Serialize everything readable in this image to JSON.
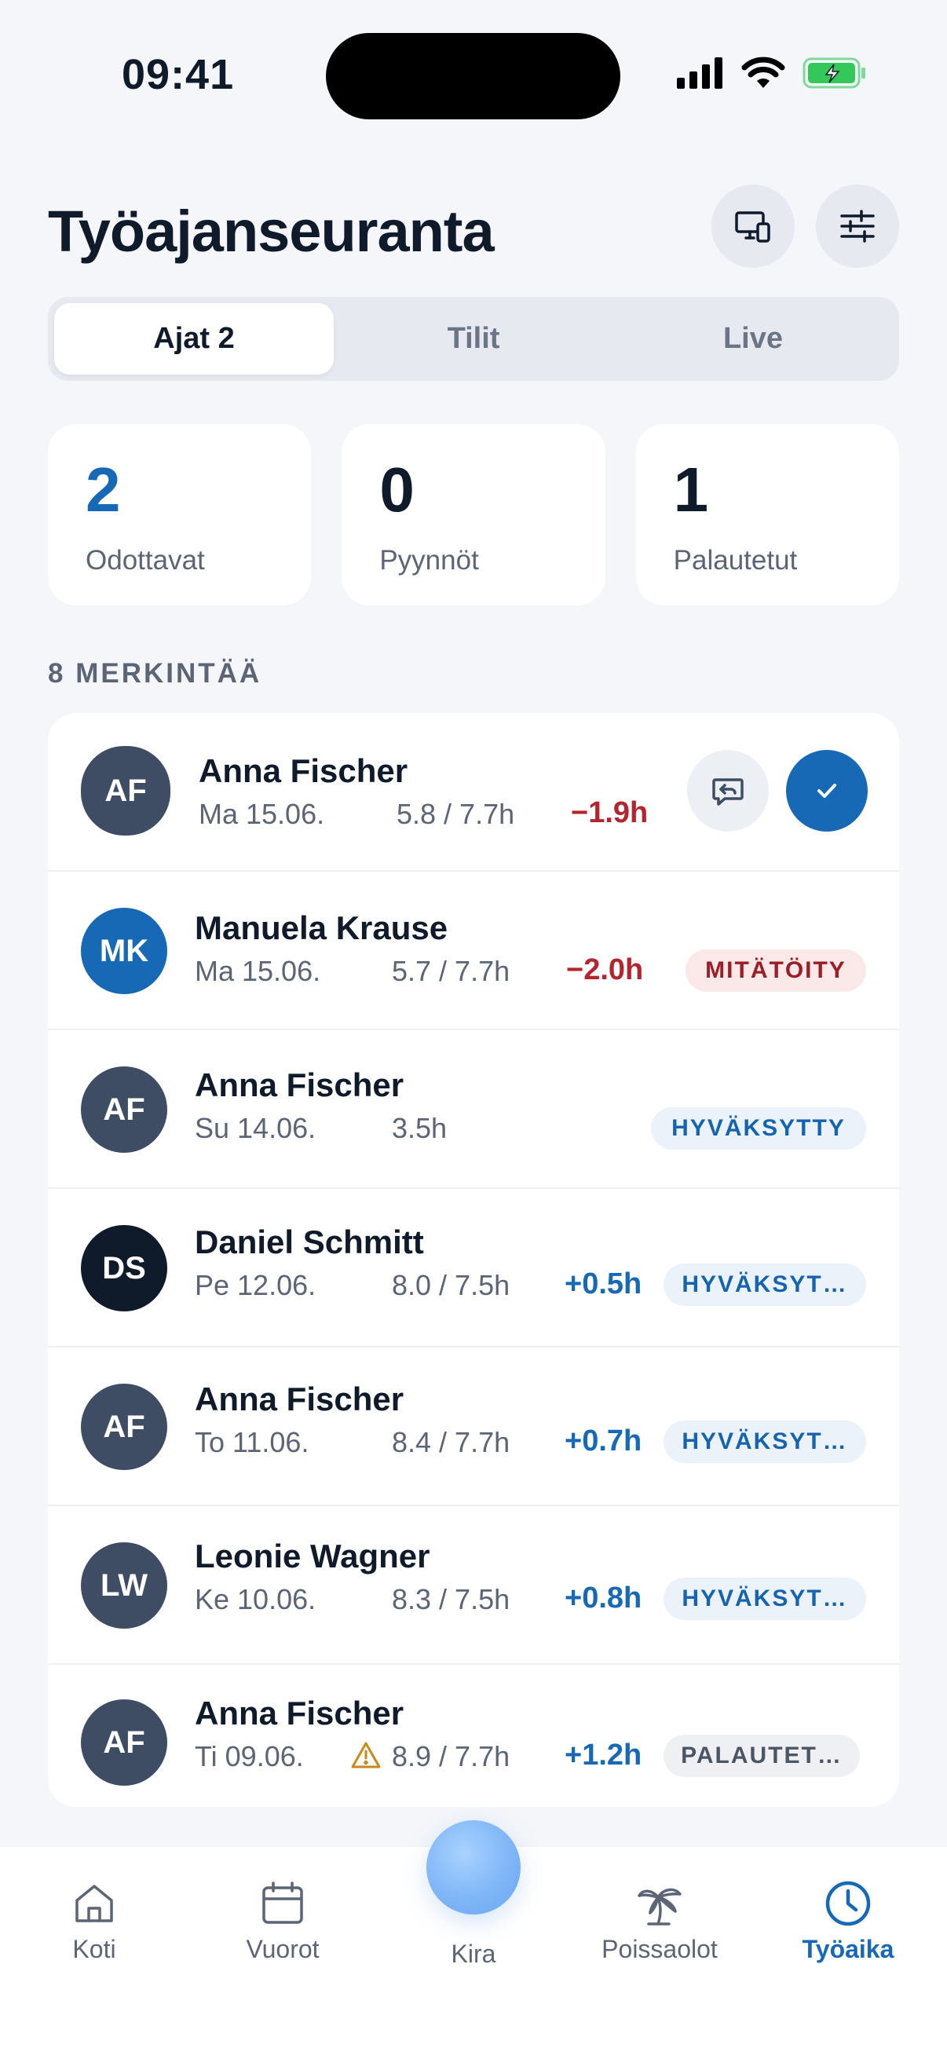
{
  "status": {
    "time": "09:41"
  },
  "header": {
    "title": "Työajanseuranta"
  },
  "segments": [
    {
      "label": "Ajat 2",
      "active": true
    },
    {
      "label": "Tilit",
      "active": false
    },
    {
      "label": "Live",
      "active": false
    }
  ],
  "stats": [
    {
      "value": "2",
      "label": "Odottavat",
      "color": "#1769b5"
    },
    {
      "value": "0",
      "label": "Pyynnöt",
      "color": "#0f1a2b"
    },
    {
      "value": "1",
      "label": "Palautetut",
      "color": "#0f1a2b"
    }
  ],
  "section": {
    "label": "8 MERKINTÄÄ"
  },
  "entries": [
    {
      "initials": "AF",
      "name": "Anna Fischer",
      "date": "Ma 15.06.",
      "hours": "5.8 / 7.7h",
      "delta": "−1.9h",
      "delta_type": "neg",
      "avatar_color": "#3f4d64",
      "status": ""
    },
    {
      "initials": "MK",
      "name": "Manuela Krause",
      "date": "Ma 15.06.",
      "hours": "5.7 / 7.7h",
      "delta": "−2.0h",
      "delta_type": "neg",
      "avatar_color": "#1769b5",
      "status": "MITÄTÖITY"
    },
    {
      "initials": "AF",
      "name": "Anna Fischer",
      "date": "Su 14.06.",
      "hours": "3.5h",
      "delta": "",
      "delta_type": "",
      "avatar_color": "#3f4d64",
      "status": "HYVÄKSYTTY"
    },
    {
      "initials": "DS",
      "name": "Daniel Schmitt",
      "date": "Pe 12.06.",
      "hours": "8.0 / 7.5h",
      "delta": "+0.5h",
      "delta_type": "pos",
      "avatar_color": "#0f1a2b",
      "status": "HYVÄKSYT…"
    },
    {
      "initials": "AF",
      "name": "Anna Fischer",
      "date": "To 11.06.",
      "hours": "8.4 / 7.7h",
      "delta": "+0.7h",
      "delta_type": "pos",
      "avatar_color": "#3f4d64",
      "status": "HYVÄKSYT…"
    },
    {
      "initials": "LW",
      "name": "Leonie Wagner",
      "date": "Ke 10.06.",
      "hours": "8.3 / 7.5h",
      "delta": "+0.8h",
      "delta_type": "pos",
      "avatar_color": "#3f4d64",
      "status": "HYVÄKSYT…"
    },
    {
      "initials": "AF",
      "name": "Anna Fischer",
      "date": "Ti 09.06.",
      "hours": "8.9 / 7.7h",
      "delta": "+1.2h",
      "delta_type": "pos",
      "avatar_color": "#3f4d64",
      "status": "PALAUTET…",
      "warning_icon": "warning-icon"
    }
  ],
  "tabs": [
    {
      "label": "Koti",
      "icon": "home-icon"
    },
    {
      "label": "Vuorot",
      "icon": "calendar-icon"
    },
    {
      "label": "Kira",
      "icon": "assistant-orb"
    },
    {
      "label": "Poissaolot",
      "icon": "palm-tree-icon"
    },
    {
      "label": "Työaika",
      "icon": "clock-icon",
      "active": true
    }
  ],
  "colors": {
    "accent": "#1769b5",
    "negative": "#b3262f",
    "background": "#f4f6fa"
  }
}
